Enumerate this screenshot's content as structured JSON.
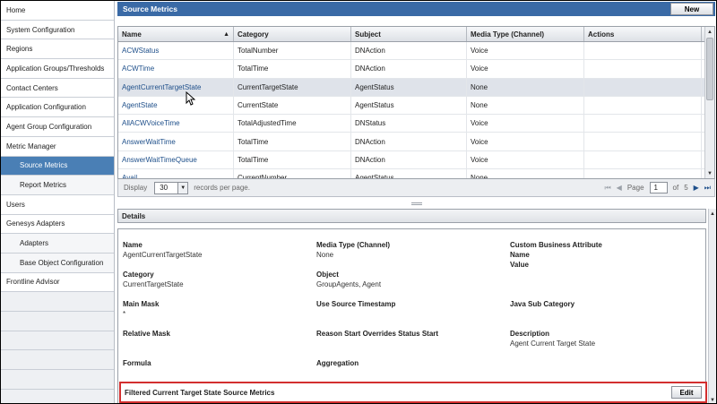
{
  "sidebar": {
    "items": [
      {
        "label": "Home"
      },
      {
        "label": "System Configuration"
      },
      {
        "label": "Regions"
      },
      {
        "label": "Application Groups/Thresholds"
      },
      {
        "label": "Contact Centers"
      },
      {
        "label": "Application Configuration"
      },
      {
        "label": "Agent Group Configuration"
      },
      {
        "label": "Metric Manager"
      },
      {
        "label": "Source Metrics"
      },
      {
        "label": "Report Metrics"
      },
      {
        "label": "Users"
      },
      {
        "label": "Genesys Adapters"
      },
      {
        "label": "Adapters"
      },
      {
        "label": "Base Object Configuration"
      },
      {
        "label": "Frontline Advisor"
      }
    ]
  },
  "header": {
    "title": "Source Metrics",
    "new_label": "New"
  },
  "table": {
    "columns": [
      "Name",
      "Category",
      "Subject",
      "Media Type (Channel)",
      "Actions"
    ],
    "rows": [
      [
        "ACWStatus",
        "TotalNumber",
        "DNAction",
        "Voice",
        ""
      ],
      [
        "ACWTime",
        "TotalTime",
        "DNAction",
        "Voice",
        ""
      ],
      [
        "AgentCurrentTargetState",
        "CurrentTargetState",
        "AgentStatus",
        "None",
        ""
      ],
      [
        "AgentState",
        "CurrentState",
        "AgentStatus",
        "None",
        ""
      ],
      [
        "AllACWVoiceTime",
        "TotalAdjustedTime",
        "DNStatus",
        "Voice",
        ""
      ],
      [
        "AnswerWaitTime",
        "TotalTime",
        "DNAction",
        "Voice",
        ""
      ],
      [
        "AnswerWaitTimeQueue",
        "TotalTime",
        "DNAction",
        "Voice",
        ""
      ],
      [
        "Avail",
        "CurrentNumber",
        "AgentStatus",
        "None",
        ""
      ]
    ]
  },
  "pager": {
    "display_label": "Display",
    "page_size": "30",
    "records_label": "records per page.",
    "page_label": "Page",
    "current_page": "1",
    "of_label": "of",
    "total_pages": "5"
  },
  "details": {
    "title": "Details",
    "fields": {
      "name": {
        "label": "Name",
        "value": "AgentCurrentTargetState"
      },
      "media_type": {
        "label": "Media Type (Channel)",
        "value": "None"
      },
      "custom_attr": {
        "label": "Custom Business Attribute"
      },
      "cba_name": {
        "label": "Name"
      },
      "cba_value": {
        "label": "Value"
      },
      "category": {
        "label": "Category",
        "value": "CurrentTargetState"
      },
      "object": {
        "label": "Object",
        "value": "GroupAgents, Agent"
      },
      "main_mask": {
        "label": "Main Mask",
        "value": "*"
      },
      "use_source_ts": {
        "label": "Use Source Timestamp"
      },
      "java_sub_category": {
        "label": "Java Sub Category"
      },
      "relative_mask": {
        "label": "Relative Mask"
      },
      "reason_start": {
        "label": "Reason Start Overrides Status Start"
      },
      "description": {
        "label": "Description",
        "value": "Agent Current Target State"
      },
      "formula": {
        "label": "Formula"
      },
      "aggregation": {
        "label": "Aggregation"
      }
    },
    "filtered_title": "Filtered Current Target State Source Metrics",
    "edit_label": "Edit"
  },
  "colors": {
    "header_blue": "#3a6aa6",
    "active_nav": "#4a7fb5",
    "highlight_red": "#d32f2f",
    "link": "#1e4f8a"
  }
}
